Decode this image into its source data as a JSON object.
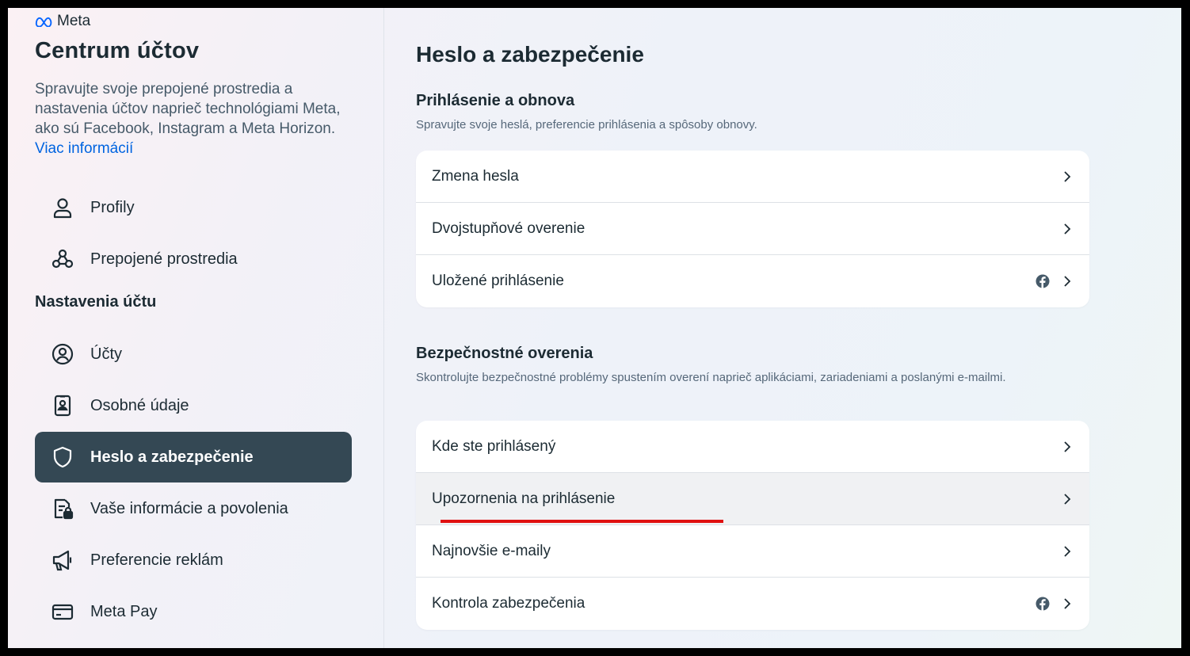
{
  "brand": {
    "name": "Meta"
  },
  "sidebar": {
    "title": "Centrum účtov",
    "description": "Spravujte svoje prepojené prostredia a nastavenia účtov naprieč technológiami Meta, ako sú Facebook, Instagram a Meta Horizon.",
    "learn_more": "Viac informácií",
    "top_items": [
      {
        "label": "Profily",
        "icon": "person-icon"
      },
      {
        "label": "Prepojené prostredia",
        "icon": "connected-experiences-icon"
      }
    ],
    "section_label": "Nastavenia účtu",
    "items": [
      {
        "label": "Účty",
        "icon": "account-circle-icon"
      },
      {
        "label": "Osobné údaje",
        "icon": "id-card-icon"
      },
      {
        "label": "Heslo a zabezpečenie",
        "icon": "shield-icon",
        "active": true
      },
      {
        "label": "Vaše informácie a povolenia",
        "icon": "document-lock-icon"
      },
      {
        "label": "Preferencie reklám",
        "icon": "megaphone-icon"
      },
      {
        "label": "Meta Pay",
        "icon": "credit-card-icon"
      }
    ]
  },
  "main": {
    "title": "Heslo a zabezpečenie",
    "login_group": {
      "title": "Prihlásenie a obnova",
      "description": "Spravujte svoje heslá, preferencie prihlásenia a spôsoby obnovy.",
      "rows": [
        {
          "label": "Zmena hesla",
          "facebook_icon": false
        },
        {
          "label": "Dvojstupňové overenie",
          "facebook_icon": false
        },
        {
          "label": "Uložené prihlásenie",
          "facebook_icon": true
        }
      ]
    },
    "security_group": {
      "title": "Bezpečnostné overenia",
      "description": "Skontrolujte bezpečnostné problémy spustením overení naprieč aplikáciami, zariadeniami a poslanými e-mailmi.",
      "rows": [
        {
          "label": "Kde ste prihlásený",
          "facebook_icon": false
        },
        {
          "label": "Upozornenia na prihlásenie",
          "facebook_icon": false,
          "highlighted": true
        },
        {
          "label": "Najnovšie e-maily",
          "facebook_icon": false
        },
        {
          "label": "Kontrola zabezpečenia",
          "facebook_icon": true
        }
      ]
    }
  },
  "colors": {
    "active_nav_bg": "#344854",
    "link": "#0064e0",
    "annotation_underline": "#e01010",
    "text": "#1c2b33"
  }
}
